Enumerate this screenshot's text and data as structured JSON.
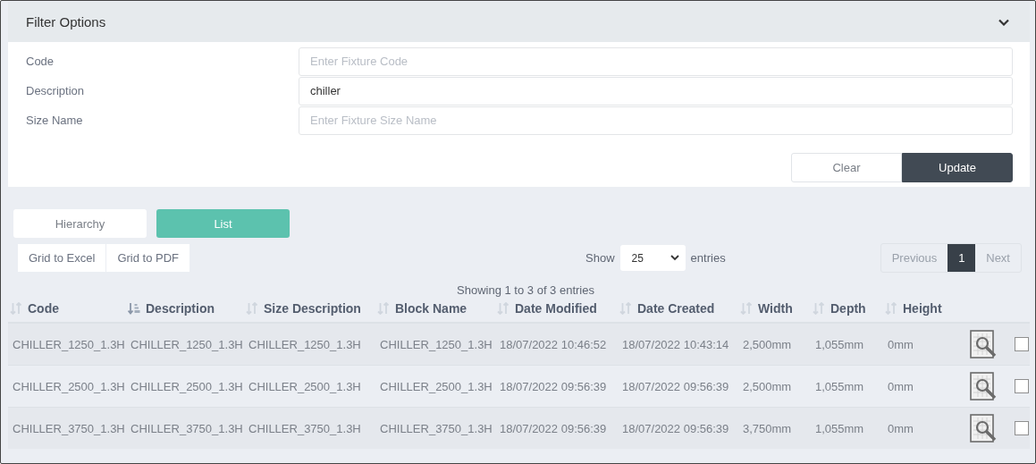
{
  "filter": {
    "title": "Filter Options",
    "expanded": true,
    "fields": [
      {
        "label": "Code",
        "placeholder": "Enter Fixture Code"
      },
      {
        "label": "Description",
        "value": "chiller"
      },
      {
        "label": "Size Name",
        "placeholder": "Enter Fixture Size Name"
      }
    ],
    "buttons": [
      {
        "label": "Clear",
        "kind": "secondary"
      },
      {
        "label": "Update",
        "kind": "primary"
      }
    ]
  },
  "views": [
    {
      "label": "Hierarchy",
      "selected": false
    },
    {
      "label": "List",
      "selected": true
    }
  ],
  "exports": [
    "Grid to Excel",
    "Grid to PDF"
  ],
  "length": {
    "before": "Show",
    "value": "25",
    "after": "entries"
  },
  "pagination": [
    {
      "label": "Previous",
      "kind": "prev",
      "selected": false
    },
    {
      "label": "1",
      "kind": "page",
      "selected": true
    },
    {
      "label": "Next",
      "kind": "next",
      "selected": false
    }
  ],
  "info": "Showing 1 to 3 of 3 entries",
  "table": {
    "columns": [
      {
        "label": "Code",
        "sorted": false
      },
      {
        "label": "Description",
        "sorted": true
      },
      {
        "label": "Size Description",
        "sorted": false
      },
      {
        "label": "Block Name",
        "sorted": false
      },
      {
        "label": "Date Modified",
        "sorted": false
      },
      {
        "label": "Date Created",
        "sorted": false
      },
      {
        "label": "Width",
        "sorted": false
      },
      {
        "label": "Depth",
        "sorted": false
      },
      {
        "label": "Height",
        "sorted": false
      }
    ],
    "rows": [
      {
        "cells": [
          "CHILLER_1250_1.3H",
          "CHILLER_1250_1.3H",
          "CHILLER_1250_1.3H",
          "CHILLER_1250_1.3H",
          "18/07/2022 10:46:52",
          "18/07/2022 10:43:14",
          "2,500mm",
          "1,055mm",
          "0mm"
        ],
        "checked": false
      },
      {
        "cells": [
          "CHILLER_2500_1.3H",
          "CHILLER_2500_1.3H",
          "CHILLER_2500_1.3H",
          "CHILLER_2500_1.3H",
          "18/07/2022 09:56:39",
          "18/07/2022 09:56:39",
          "2,500mm",
          "1,055mm",
          "0mm"
        ],
        "checked": false
      },
      {
        "cells": [
          "CHILLER_3750_1.3H",
          "CHILLER_3750_1.3H",
          "CHILLER_3750_1.3H",
          "CHILLER_3750_1.3H",
          "18/07/2022 09:56:39",
          "18/07/2022 09:56:39",
          "3,750mm",
          "1,055mm",
          "0mm"
        ],
        "checked": false
      }
    ]
  }
}
